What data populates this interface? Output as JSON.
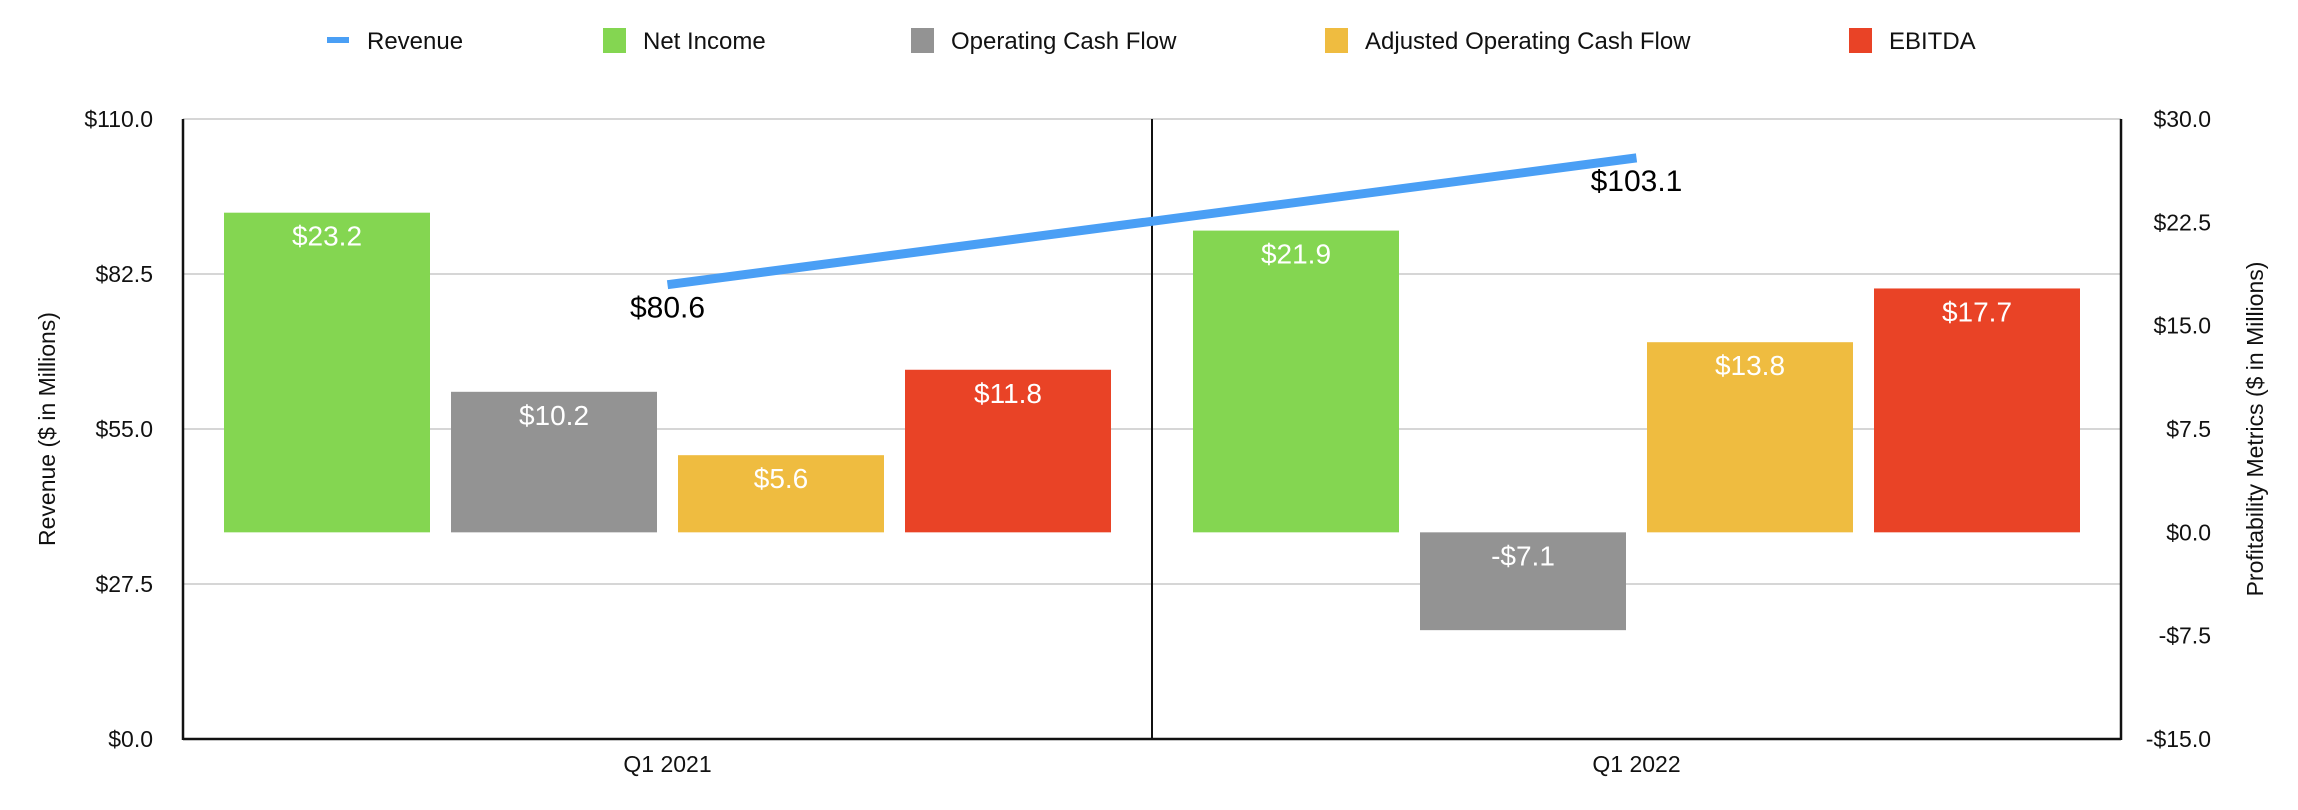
{
  "chart_data": {
    "type": "bar",
    "title": "",
    "categories": [
      "Q1 2021",
      "Q1 2022"
    ],
    "legend_position": "top",
    "grid": true,
    "left_axis": {
      "label": "Revenue ($ in Millions)",
      "range": [
        0,
        110
      ],
      "ticks": [
        0,
        27.5,
        55,
        82.5,
        110
      ],
      "tick_labels": [
        "$0.0",
        "$27.5",
        "$55.0",
        "$82.5",
        "$110.0"
      ]
    },
    "right_axis": {
      "label": "Profitability Metrics ($ in Millions)",
      "range": [
        -15,
        30
      ],
      "ticks": [
        -15,
        -7.5,
        0,
        7.5,
        15,
        22.5,
        30
      ],
      "tick_labels": [
        "-$15.0",
        "-$7.5",
        "$0.0",
        "$7.5",
        "$15.0",
        "$22.5",
        "$30.0"
      ]
    },
    "series": [
      {
        "name": "Revenue",
        "kind": "line",
        "axis": "left",
        "color": "#4A9FF5",
        "values": [
          80.6,
          103.1
        ],
        "labels": [
          "$80.6",
          "$103.1"
        ]
      },
      {
        "name": "Net Income",
        "kind": "bar",
        "axis": "right",
        "color": "#84D651",
        "values": [
          23.2,
          21.9
        ],
        "labels": [
          "$23.2",
          "$21.9"
        ]
      },
      {
        "name": "Operating Cash Flow",
        "kind": "bar",
        "axis": "right",
        "color": "#939393",
        "values": [
          10.2,
          -7.1
        ],
        "labels": [
          "$10.2",
          "-$7.1"
        ]
      },
      {
        "name": "Adjusted Operating Cash Flow",
        "kind": "bar",
        "axis": "right",
        "color": "#EFBC40",
        "values": [
          5.6,
          13.8
        ],
        "labels": [
          "$5.6",
          "$13.8"
        ]
      },
      {
        "name": "EBITDA",
        "kind": "bar",
        "axis": "right",
        "color": "#E94326",
        "values": [
          11.8,
          17.7
        ],
        "labels": [
          "$11.8",
          "$17.7"
        ]
      }
    ]
  }
}
